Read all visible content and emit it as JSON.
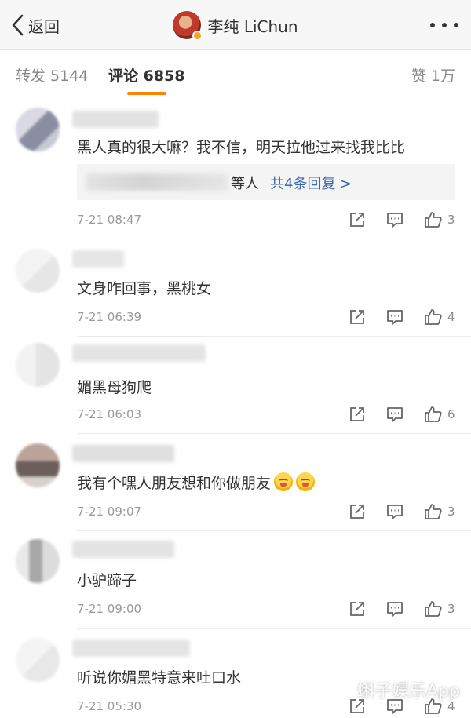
{
  "nav": {
    "back_label": "返回",
    "user_name": "李纯 LiChun"
  },
  "tabs": {
    "repost_label": "转发 5144",
    "comments_label": "评论 6858",
    "likes_label": "赞 1万"
  },
  "comments": [
    {
      "text": "黑人真的很大嘛？我不信，明天拉他过来找我比比",
      "time": "7-21 08:47",
      "likes": "3",
      "reply": {
        "who": "等人",
        "link": "共4条回复 >"
      }
    },
    {
      "text": "文身咋回事，黑桃女",
      "time": "7-21 06:39",
      "likes": "4"
    },
    {
      "text": "媚黑母狗爬",
      "time": "7-21 06:03",
      "likes": "6"
    },
    {
      "text": "我有个嘿人朋友想和你做朋友",
      "time": "7-21 09:07",
      "likes": "3"
    },
    {
      "text": "小驴蹄子",
      "time": "7-21 09:00",
      "likes": "3"
    },
    {
      "text": "听说你媚黑特意来吐口水",
      "time": "7-21 05:30",
      "likes": "4"
    }
  ],
  "watermark": "蝌子娱乐App"
}
